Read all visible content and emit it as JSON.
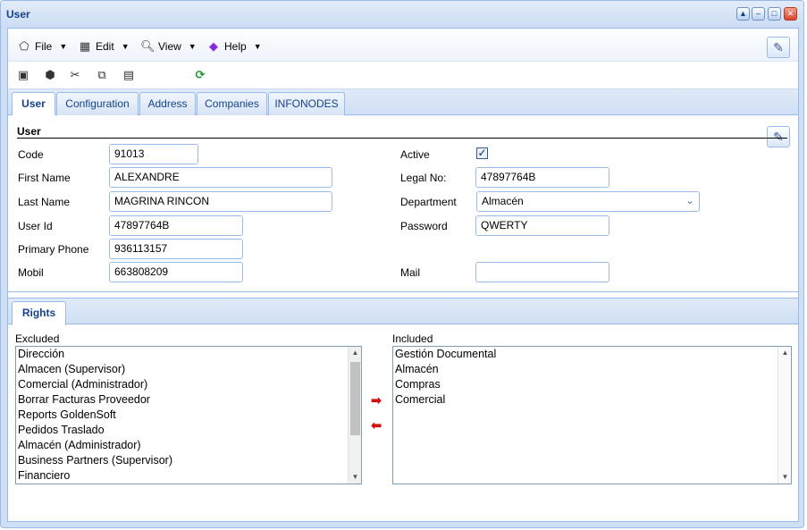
{
  "window": {
    "title": "User"
  },
  "menu": [
    {
      "label": "File",
      "icon": "file-icon"
    },
    {
      "label": "Edit",
      "icon": "edit-icon"
    },
    {
      "label": "View",
      "icon": "view-icon"
    },
    {
      "label": "Help",
      "icon": "help-icon"
    }
  ],
  "tabs": [
    {
      "label": "User"
    },
    {
      "label": "Configuration"
    },
    {
      "label": "Address"
    },
    {
      "label": "Companies"
    },
    {
      "label": "INFONODES"
    }
  ],
  "form": {
    "section_title": "User",
    "code": {
      "label": "Code",
      "value": "91013"
    },
    "first_name": {
      "label": "First Name",
      "value": "ALEXANDRE"
    },
    "last_name": {
      "label": "Last Name",
      "value": "MAGRINA RINCON"
    },
    "user_id": {
      "label": "User Id",
      "value": "47897764B"
    },
    "primary_phone": {
      "label": "Primary Phone",
      "value": "936113157"
    },
    "mobil": {
      "label": "Mobil",
      "value": "663808209"
    },
    "active": {
      "label": "Active",
      "checked": true,
      "mark": "✓"
    },
    "legal_no": {
      "label": "Legal No:",
      "value": "47897764B"
    },
    "department": {
      "label": "Department",
      "value": "Almacén"
    },
    "password": {
      "label": "Password",
      "value": "QWERTY"
    },
    "mail": {
      "label": "Mail",
      "value": ""
    }
  },
  "rights": {
    "tab_label": "Rights",
    "excluded_label": "Excluded",
    "included_label": "Included",
    "excluded": [
      "Dirección",
      "Almacen (Supervisor)",
      "Comercial (Administrador)",
      "Borrar Facturas Proveedor",
      "Reports GoldenSoft",
      "Pedidos Traslado",
      "Almacén (Administrador)",
      "Business Partners (Supervisor)",
      "Financiero"
    ],
    "included": [
      "Gestión Documental",
      "Almacén",
      "Compras",
      "Comercial"
    ]
  },
  "colors": {
    "accent": "#15428b",
    "border": "#99bbe8",
    "arrow": "#d01010"
  }
}
